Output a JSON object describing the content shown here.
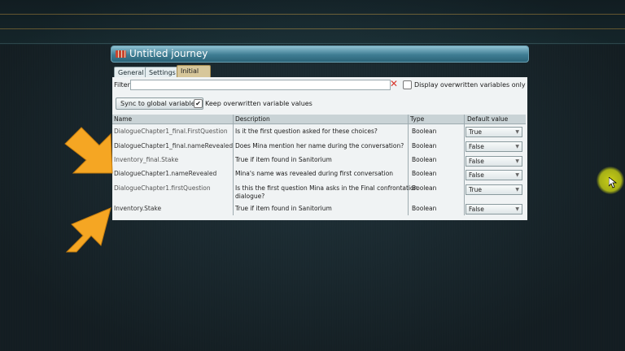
{
  "window": {
    "title": "Untitled journey",
    "tabs": [
      {
        "label": "General",
        "active": false
      },
      {
        "label": "Settings",
        "active": false
      },
      {
        "label": "Initial variable values",
        "active": true
      }
    ]
  },
  "filter": {
    "label": "Filter:",
    "value": "",
    "display_overwritten_label": "Display overwritten variables only",
    "display_overwritten_checked": false
  },
  "actions": {
    "sync_label": "Sync to global variables",
    "keep_label": "Keep overwritten variable values",
    "keep_checked": true
  },
  "table": {
    "columns": [
      "Name",
      "Description",
      "Type",
      "Default value"
    ],
    "rows": [
      {
        "name": "DialogueChapter1_final.FirstQuestion",
        "description": "Is it the first question asked for these choices?",
        "description2": "",
        "type": "Boolean",
        "value": "True"
      },
      {
        "name": "DialogueChapter1_final.nameRevealed",
        "description": "Does Mina mention her name during the conversation?",
        "description2": "",
        "type": "Boolean",
        "value": "False"
      },
      {
        "name": "Inventory_final.Stake",
        "description": "True if item found in Sanitorium",
        "description2": "",
        "type": "Boolean",
        "value": "False"
      },
      {
        "name": "DialogueChapter1.nameRevealed",
        "description": "Mina's name was revealed during first conversation",
        "description2": "",
        "type": "Boolean",
        "value": "False"
      },
      {
        "name": "DialogueChapter1.firstQuestion",
        "description": "Is this the first question Mina asks in the Final confrontation",
        "description2": "dialogue?",
        "type": "Boolean",
        "value": "True"
      },
      {
        "name": "Inventory.Stake",
        "description": "True if item found in Sanitorium",
        "description2": "",
        "type": "Boolean",
        "value": "False"
      }
    ]
  },
  "colors": {
    "accent_arrow": "#f5a623",
    "titlebar": "#4a8aa0",
    "active_tab": "#d7c79a",
    "cursor_highlight": "#d2d614"
  }
}
